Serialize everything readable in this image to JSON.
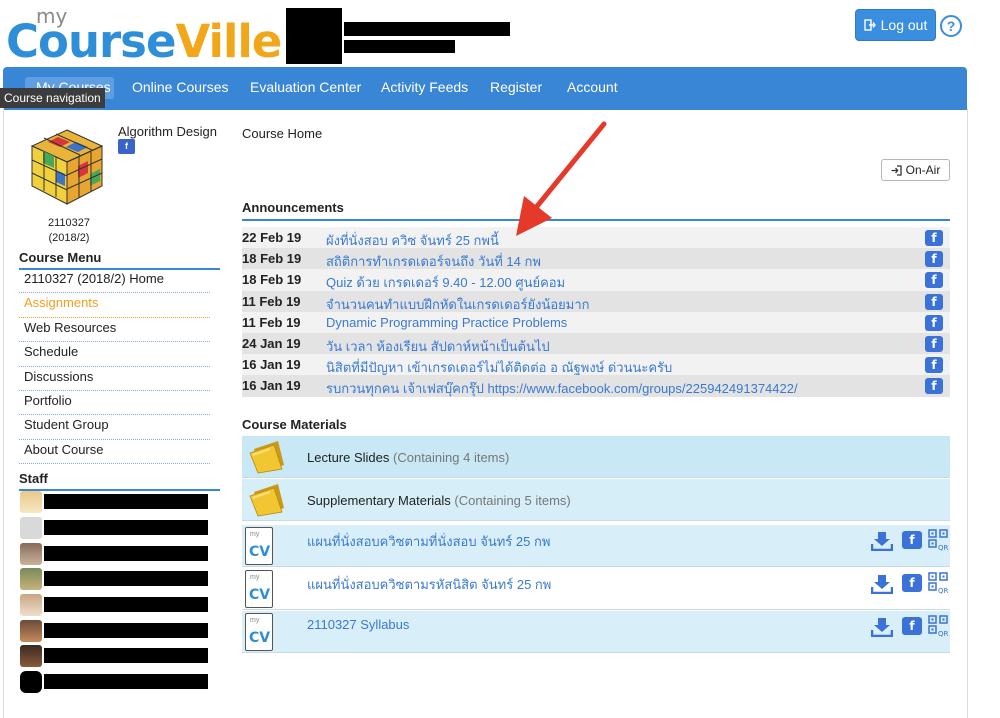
{
  "header": {
    "logo_my": "my",
    "logo_course": "Course",
    "logo_ville": "Ville",
    "logout_label": "Log out",
    "help_label": "?"
  },
  "nav": {
    "items": [
      "My Courses",
      "Online Courses",
      "Evaluation Center",
      "Activity Feeds",
      "Register",
      "Account"
    ],
    "tooltip": "Course navigation"
  },
  "sidebar": {
    "course_name": "Algorithm Design",
    "course_code": "2110327",
    "course_term": "(2018/2)",
    "menu_title": "Course Menu",
    "menu_items": [
      "2110327 (2018/2) Home",
      "Assignments",
      "Web Resources",
      "Schedule",
      "Discussions",
      "Portfolio",
      "Student Group",
      "About Course"
    ],
    "selected_index": 1,
    "staff_title": "Staff"
  },
  "main": {
    "breadcrumb": "Course Home",
    "onair_label": "On-Air",
    "announcements_title": "Announcements",
    "announcements": [
      {
        "date": "22 Feb 19",
        "title": "ผังที่นั่งสอบ ควิซ จันทร์ 25 กพนี้"
      },
      {
        "date": "18 Feb 19",
        "title": "สถิติการทำเกรดเดอร์จนถึง วันที่ 14 กพ"
      },
      {
        "date": "18 Feb 19",
        "title": "Quiz ด้วย เกรดเดอร์ 9.40 - 12.00 ศูนย์คอม"
      },
      {
        "date": "11 Feb 19",
        "title": "จำนวนคนทำแบบฝึกหัดในเกรดเดอร์ยังน้อยมาก"
      },
      {
        "date": "11 Feb 19",
        "title": "Dynamic Programming Practice Problems"
      },
      {
        "date": "24 Jan 19",
        "title": "วัน เวลา ห้องเรียน สัปดาห์หน้าเป็นต้นไป"
      },
      {
        "date": "16 Jan 19",
        "title": "นิสิตที่มีปัญหา เข้าเกรดเดอร์ไม่ได้ติดต่อ อ ณัฐพงษ์ ด่วนนะครับ"
      },
      {
        "date": "16 Jan 19",
        "title": "รบกวนทุกคน เจ้าเฟสบุ๊คกรุ๊ป https://www.facebook.com/groups/225942491374422/"
      }
    ],
    "materials_title": "Course Materials",
    "folders": [
      {
        "name": "Lecture Slides",
        "count": "(Containing 4 items)"
      },
      {
        "name": "Supplementary Materials",
        "count": "(Containing 5 items)"
      }
    ],
    "files": [
      {
        "name": "แผนที่นั่งสอบควิซตามที่นั่งสอบ จันทร์ 25 กพ"
      },
      {
        "name": "แผนที่นั่งสอบควิซตามรหัสนิสิต จันทร์ 25 กพ"
      },
      {
        "name": "2110327 Syllabus"
      }
    ],
    "cv_icon_label": "CV",
    "cv_icon_small": "my",
    "qr_label": "QR",
    "fb_label": "f"
  },
  "colors": {
    "brand_blue": "#3a86d6",
    "brand_orange": "#f2a71b",
    "link_blue": "#3a7ad0"
  }
}
